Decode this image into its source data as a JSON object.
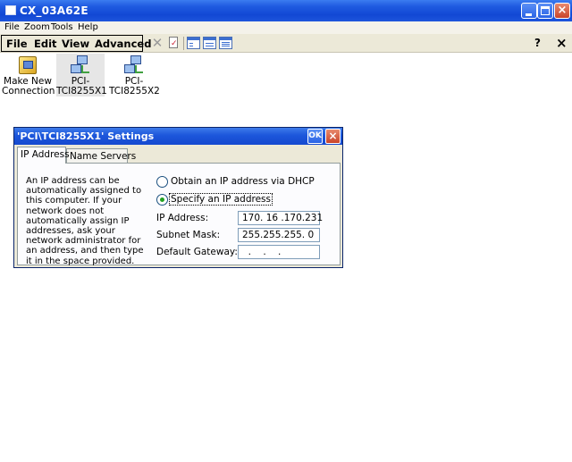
{
  "window": {
    "title": "CX_03A62E"
  },
  "menu": {
    "items": [
      "File",
      "Zoom",
      "Tools",
      "Help"
    ]
  },
  "command_bar": {
    "menus": [
      "File",
      "Edit",
      "View",
      "Advanced"
    ],
    "tools": [
      "delete-icon",
      "properties-icon",
      "large-icons-view-icon",
      "small-icons-view-icon",
      "details-view-icon"
    ],
    "help": "?",
    "close": "×"
  },
  "desktop_icons": [
    {
      "label_line1": "Make New",
      "label_line2": "Connection",
      "icon": "connection-wizard-icon"
    },
    {
      "label_line1": "PCI-",
      "label_line2": "TCI8255X1",
      "icon": "network-adapter-icon",
      "selected": true
    },
    {
      "label_line1": "PCI-",
      "label_line2": "TCI8255X2",
      "icon": "network-adapter-icon"
    }
  ],
  "dialog": {
    "title": "'PCI\\TCI8255X1' Settings",
    "ok_label": "OK",
    "close_label": "×",
    "tabs": [
      "IP Address",
      "Name Servers"
    ],
    "active_tab": "IP Address",
    "description": "An IP address can be automatically assigned to this computer.  If your network does not automatically assign IP addresses, ask your network administrator for an address, and then type it in the space provided.",
    "options": {
      "dhcp": "Obtain an IP address via DHCP",
      "specify": "Specify an IP address",
      "selected": "specify"
    },
    "fields": {
      "ip_label": "IP Address:",
      "ip_value": "170. 16 .170.231",
      "mask_label": "Subnet Mask:",
      "mask_value": "255.255.255. 0",
      "gateway_label": "Default Gateway:",
      "gateway_value": "  .    .    .  "
    }
  }
}
